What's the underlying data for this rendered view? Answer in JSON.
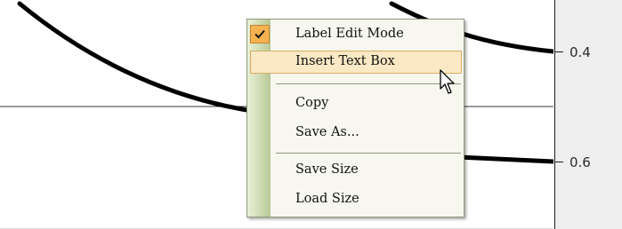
{
  "axis": {
    "ticks": [
      {
        "label": "0.4"
      },
      {
        "label": "0.6"
      }
    ]
  },
  "context_menu": {
    "items": [
      {
        "label": "Label Edit Mode",
        "checked": true
      },
      {
        "label": "Insert Text Box",
        "highlighted": true
      },
      {
        "label": "Copy"
      },
      {
        "label": "Save As..."
      },
      {
        "label": "Save Size"
      },
      {
        "label": "Load Size"
      }
    ]
  },
  "colors": {
    "menu_background": "#f7f7ef",
    "menu_hover": "#fbe9c5",
    "check_background": "#f6b24f",
    "curve": "#000000"
  },
  "cursor": {
    "icon": "arrow-cursor-icon"
  }
}
